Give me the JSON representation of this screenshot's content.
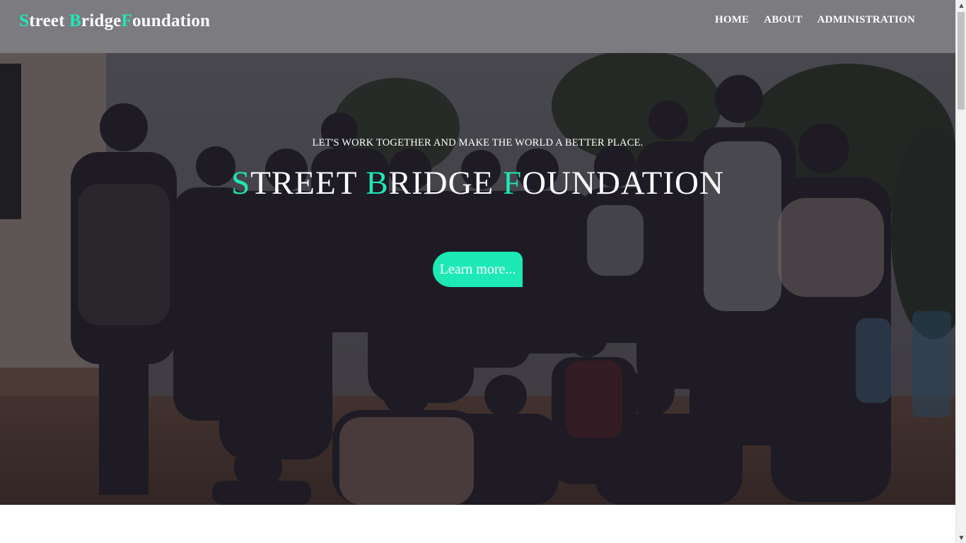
{
  "brand": {
    "first_letter_1": "S",
    "rest_1": "treet ",
    "first_letter_2": "B",
    "rest_2": "ridge",
    "first_letter_3": "F",
    "rest_3": "oundation"
  },
  "nav": {
    "items": [
      {
        "label": "HOME"
      },
      {
        "label": "ABOUT"
      },
      {
        "label": "ADMINISTRATION"
      }
    ]
  },
  "hero": {
    "tagline": "LET'S WORK TOGETHER AND MAKE THE WORLD A BETTER PLACE.",
    "title": {
      "letter_1": "S",
      "rest_1": "TREET ",
      "letter_2": "B",
      "rest_2": "RIDGE ",
      "letter_3": "F",
      "rest_3": "OUNDATION"
    },
    "cta_label": "Learn more..."
  },
  "colors": {
    "accent": "#1de9b6",
    "navbar": "#808084",
    "text": "#ffffff"
  },
  "scrollbar": {
    "up_icon": "scroll-up-arrow-icon",
    "down_icon": "scroll-down-arrow-icon"
  }
}
